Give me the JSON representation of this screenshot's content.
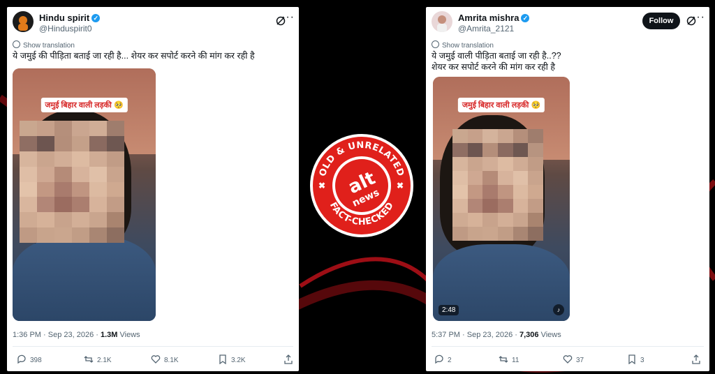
{
  "left_tweet": {
    "name": "Hindu spirit",
    "handle": "@Hinduspirit0",
    "show_translation": "Show translation",
    "text": "ये जमुई की पीड़िता बताई जा रही है... शेयर कर सपोर्ट करने की मांग कर रही है",
    "video_caption": "जमुई बिहार वाली लड़की 🥺",
    "time": "1:36 PM · Sep 23, 2026 ·",
    "views": "1.3M",
    "views_label": "Views",
    "replies": "398",
    "reposts": "2.1K",
    "likes": "8.1K",
    "bookmarks": "3.2K"
  },
  "right_tweet": {
    "name": "Amrita mishra",
    "handle": "@Amrita_2121",
    "follow_label": "Follow",
    "show_translation": "Show translation",
    "text_line1": "ये जमुई वाली पीड़िता बताई जा रही है..??",
    "text_line2": "शेयर कर सपोर्ट करने की मांग कर रही है",
    "video_caption": "जमुई बिहार वाली लड़की 🥺",
    "duration": "2:48",
    "time": "5:37 PM · Sep 23, 2026 ·",
    "views": "7,306",
    "views_label": "Views",
    "replies": "2",
    "reposts": "11",
    "likes": "37",
    "bookmarks": "3"
  },
  "badge": {
    "top_text": "OLD & UNRELATED",
    "brand_line1": "alt",
    "brand_line2": "news",
    "bottom_text": "FACT-CHECKED",
    "color": "#e0201b"
  },
  "colors": {
    "verified": "#1d9bf0",
    "text_secondary": "#536471",
    "text_primary": "#0f1419"
  }
}
